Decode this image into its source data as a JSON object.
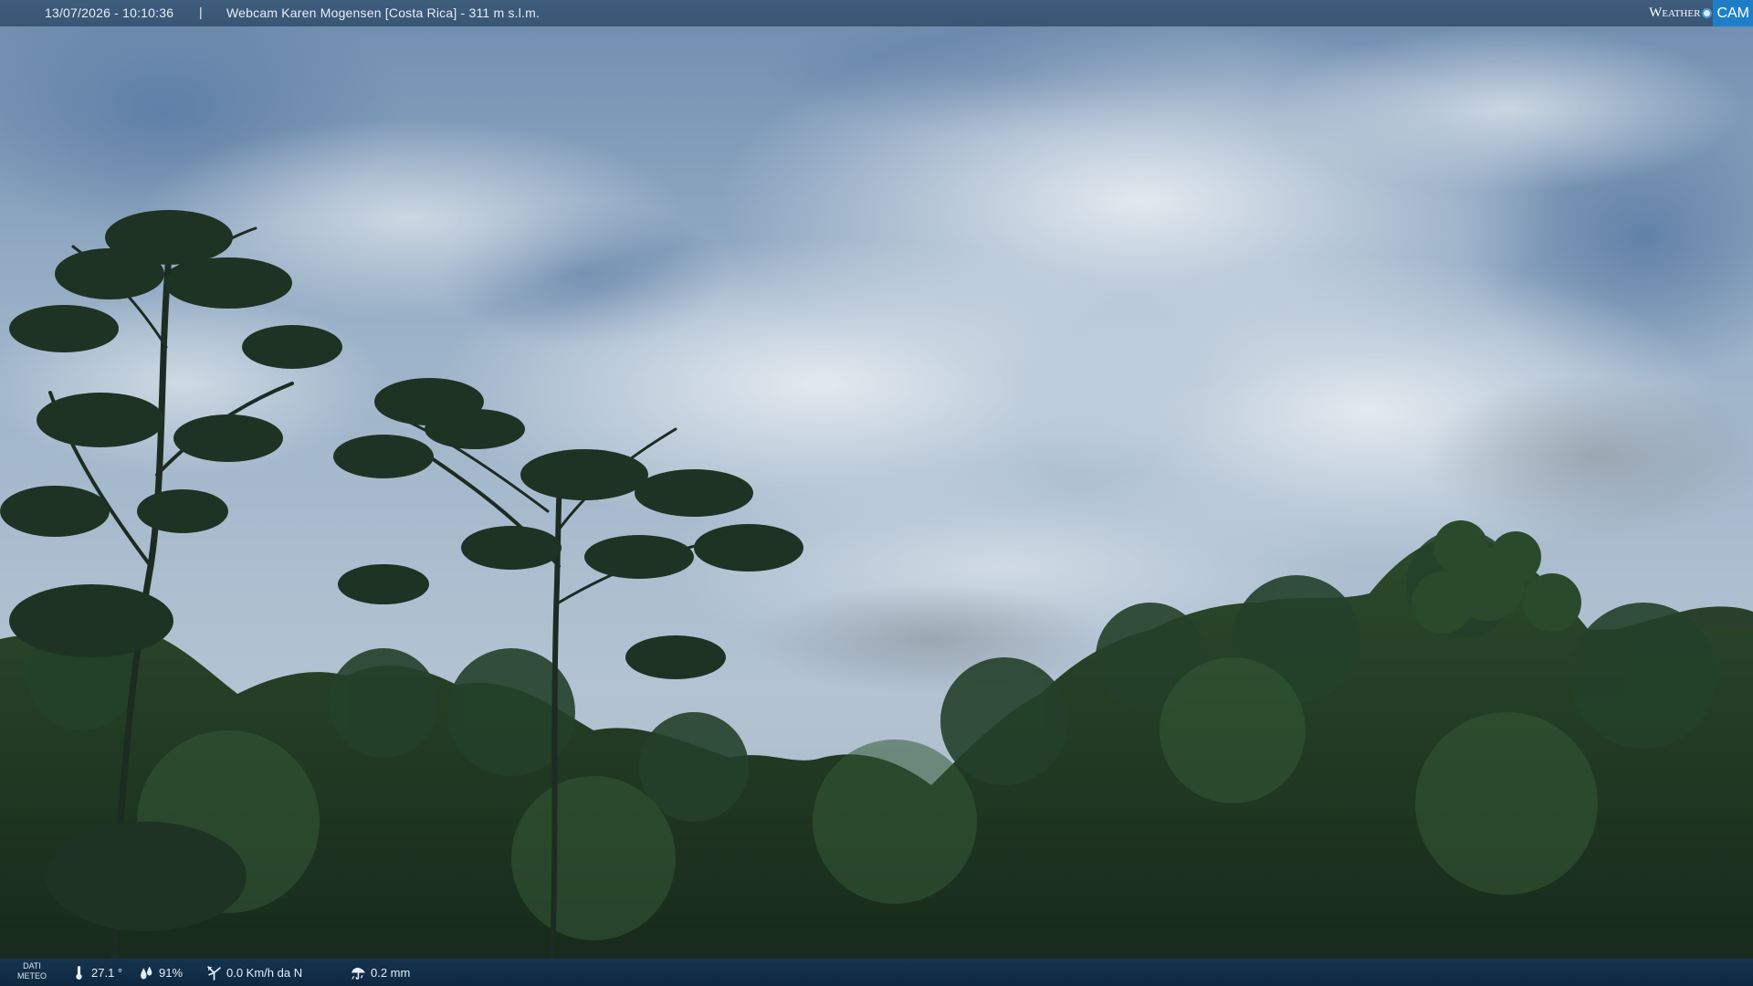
{
  "overlay": {
    "timestamp": "13/07/2026 - 10:10:36",
    "separator": "|",
    "title": "Webcam Karen Mogensen [Costa Rica] - 311 m s.l.m.",
    "brand": {
      "weather": "Weather",
      "cam": "CAM",
      "accent_color": "#1e7fc8"
    }
  },
  "weather": {
    "dati_line1": "DATI",
    "dati_line2": "METEO",
    "temperature": "27.1 °",
    "humidity": "91%",
    "wind": "0.0 Km/h da N",
    "rain": "0.2 mm",
    "icons": [
      "thermometer-icon",
      "humidity-drop-icon",
      "wind-icon",
      "rain-icon"
    ]
  },
  "scene": {
    "description_colors": {
      "sky": "#9fb4c8",
      "cloud": "#d9e2ea",
      "forest": "#1f3a22"
    }
  }
}
